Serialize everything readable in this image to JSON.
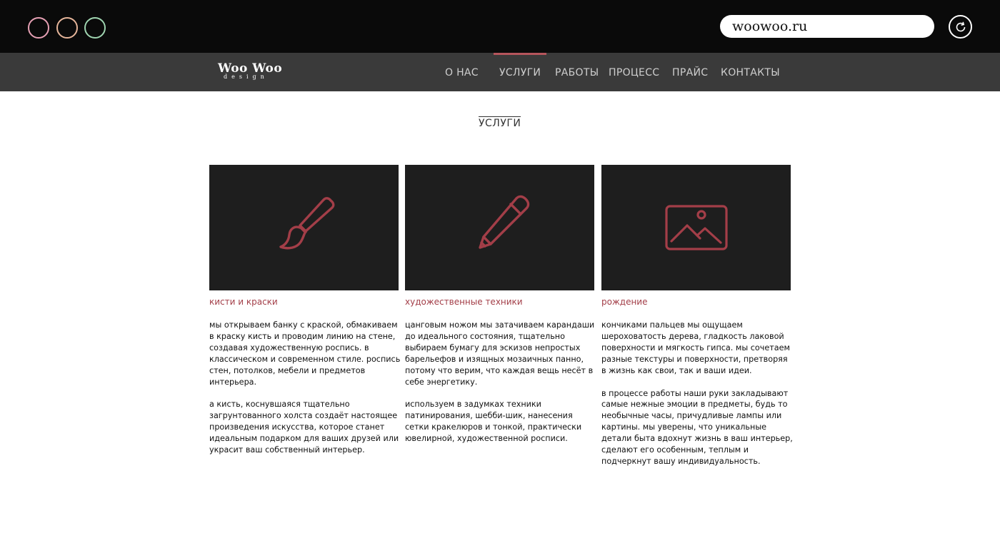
{
  "browser": {
    "url": "woowoo.ru",
    "window_buttons": [
      "close",
      "minimize",
      "maximize"
    ],
    "reload_icon": "reload-icon"
  },
  "site": {
    "logo": {
      "main": "Woo Woo",
      "sub": "design"
    },
    "nav": [
      {
        "label": "о нас"
      },
      {
        "label": "услуги",
        "active": true
      },
      {
        "label": "работы"
      },
      {
        "label": "процесс"
      },
      {
        "label": "прайс"
      },
      {
        "label": "контакты"
      }
    ],
    "accent_color": "#b5555c"
  },
  "main": {
    "section_title": "услуги",
    "cards": [
      {
        "icon": "paintbrush-icon",
        "title": "кисти и краски",
        "paragraphs": [
          "мы открываем банку с краской, обмакиваем в краску кисть и проводим линию на стене, создавая художественную роспись. в классическом и современном стиле. роспись стен, потолков, мебели и предметов интерьера.",
          "а кисть, коснувшаяся тщательно загрунтованного холста создаёт настоящее произведения искусства, которое станет идеальным подарком для ваших друзей или украсит ваш собственный интерьер."
        ]
      },
      {
        "icon": "pencil-icon",
        "title": "художественные техники",
        "paragraphs": [
          "цанговым ножом мы затачиваем карандаши до идеального состояния, тщательно выбираем бумагу для эскизов непростых барельефов и изящных мозаичных панно, потому что верим, что каждая вещь несёт в себе энергетику.",
          "используем в задумках техники патинирования, шебби-шик, нанесения сетки кракелюров и тонкой, практически ювелирной, художественной росписи."
        ]
      },
      {
        "icon": "image-icon",
        "title": "рождение",
        "paragraphs": [
          "кончиками пальцев мы ощущаем шероховатость дерева, гладкость лаковой поверхности и мягкость гипса. мы сочетаем разные текстуры и поверхности, претворяя в жизнь как свои, так и ваши идеи.",
          "в процессе работы наши руки закладывают самые нежные эмоции в предметы, будь то необычные часы, причудливые лампы или картины. мы уверены, что уникальные детали быта вдохнут жизнь в ваш интерьер, сделают его особенным, теплым и подчеркнут вашу индивидуальность."
        ]
      }
    ]
  }
}
